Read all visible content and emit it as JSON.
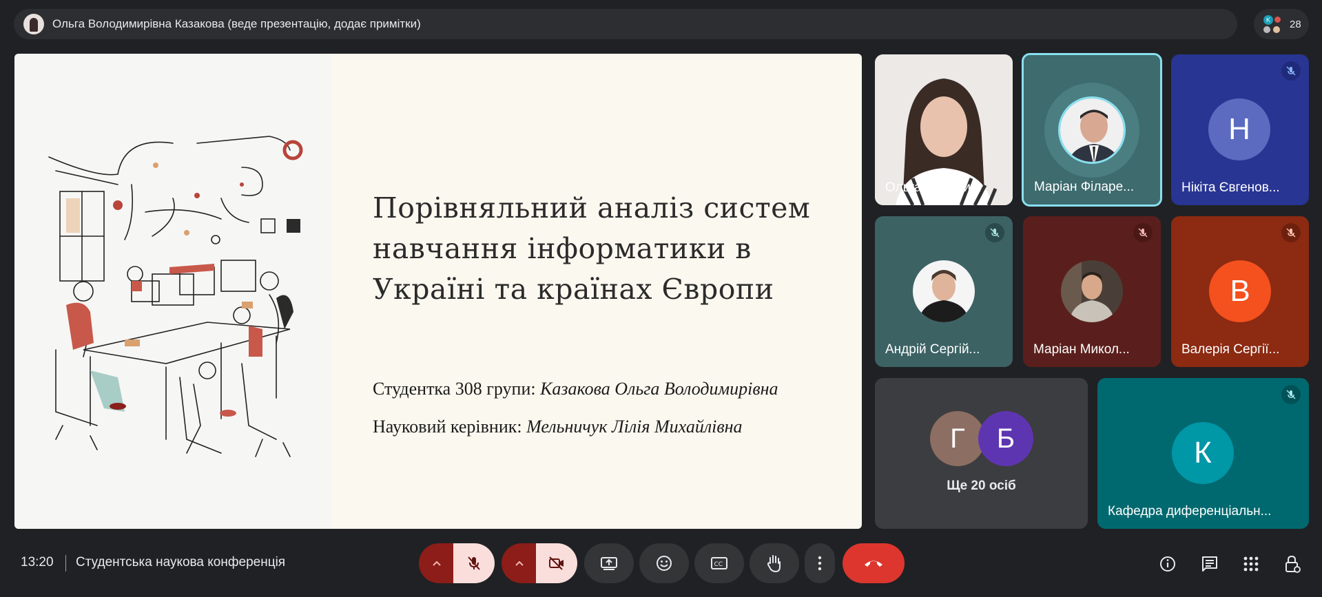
{
  "presenter_bar": {
    "text": "Ольга Володимирівна Казакова (веде презентацію, додає примітки)",
    "people_count": "28",
    "people_avatar_letter": "K"
  },
  "slide": {
    "title_lines": [
      "Порівняльний аналіз систем",
      "навчання інформатики в",
      "Україні та країнах Європи"
    ],
    "student_label": "Студентка 308 групи:",
    "student_name": "Казакова Ольга Володимирівна",
    "supervisor_label": "Науковий керівник:",
    "supervisor_name": "Мельничук Лілія Михайлівна"
  },
  "participants": [
    {
      "name": "Ольга Володи...",
      "muted": false
    },
    {
      "name": "Маріан Філаре...",
      "muted": false,
      "speaking": true
    },
    {
      "name": "Нікіта Євгенов...",
      "muted": true,
      "letter": "Н",
      "color": "#5c6bc0"
    },
    {
      "name": "Андрій Сергій...",
      "muted": true
    },
    {
      "name": "Маріан Микол...",
      "muted": true
    },
    {
      "name": "Валерія Сергії...",
      "muted": true,
      "letter": "В",
      "color": "#f4511e"
    },
    {
      "name": "Кафедра диференціальн...",
      "muted": true,
      "letter": "К",
      "color": "#0097a7"
    }
  ],
  "others": {
    "letters": [
      "Г",
      "Б"
    ],
    "colors": [
      "#8d6e63",
      "#5e35b1"
    ],
    "label": "Ще 20 осіб"
  },
  "bottom": {
    "time": "13:20",
    "meeting_title": "Студентська наукова конференція"
  },
  "icons": [
    "mic-off-icon",
    "camera-off-icon",
    "present-icon",
    "emoji-icon",
    "captions-icon",
    "raise-hand-icon",
    "more-icon",
    "leave-call-icon",
    "info-icon",
    "chat-icon",
    "activities-icon",
    "host-controls-icon"
  ],
  "colors": {
    "background": "#202124",
    "leave": "#dc362e",
    "speaking_border": "#8ae0f0"
  }
}
